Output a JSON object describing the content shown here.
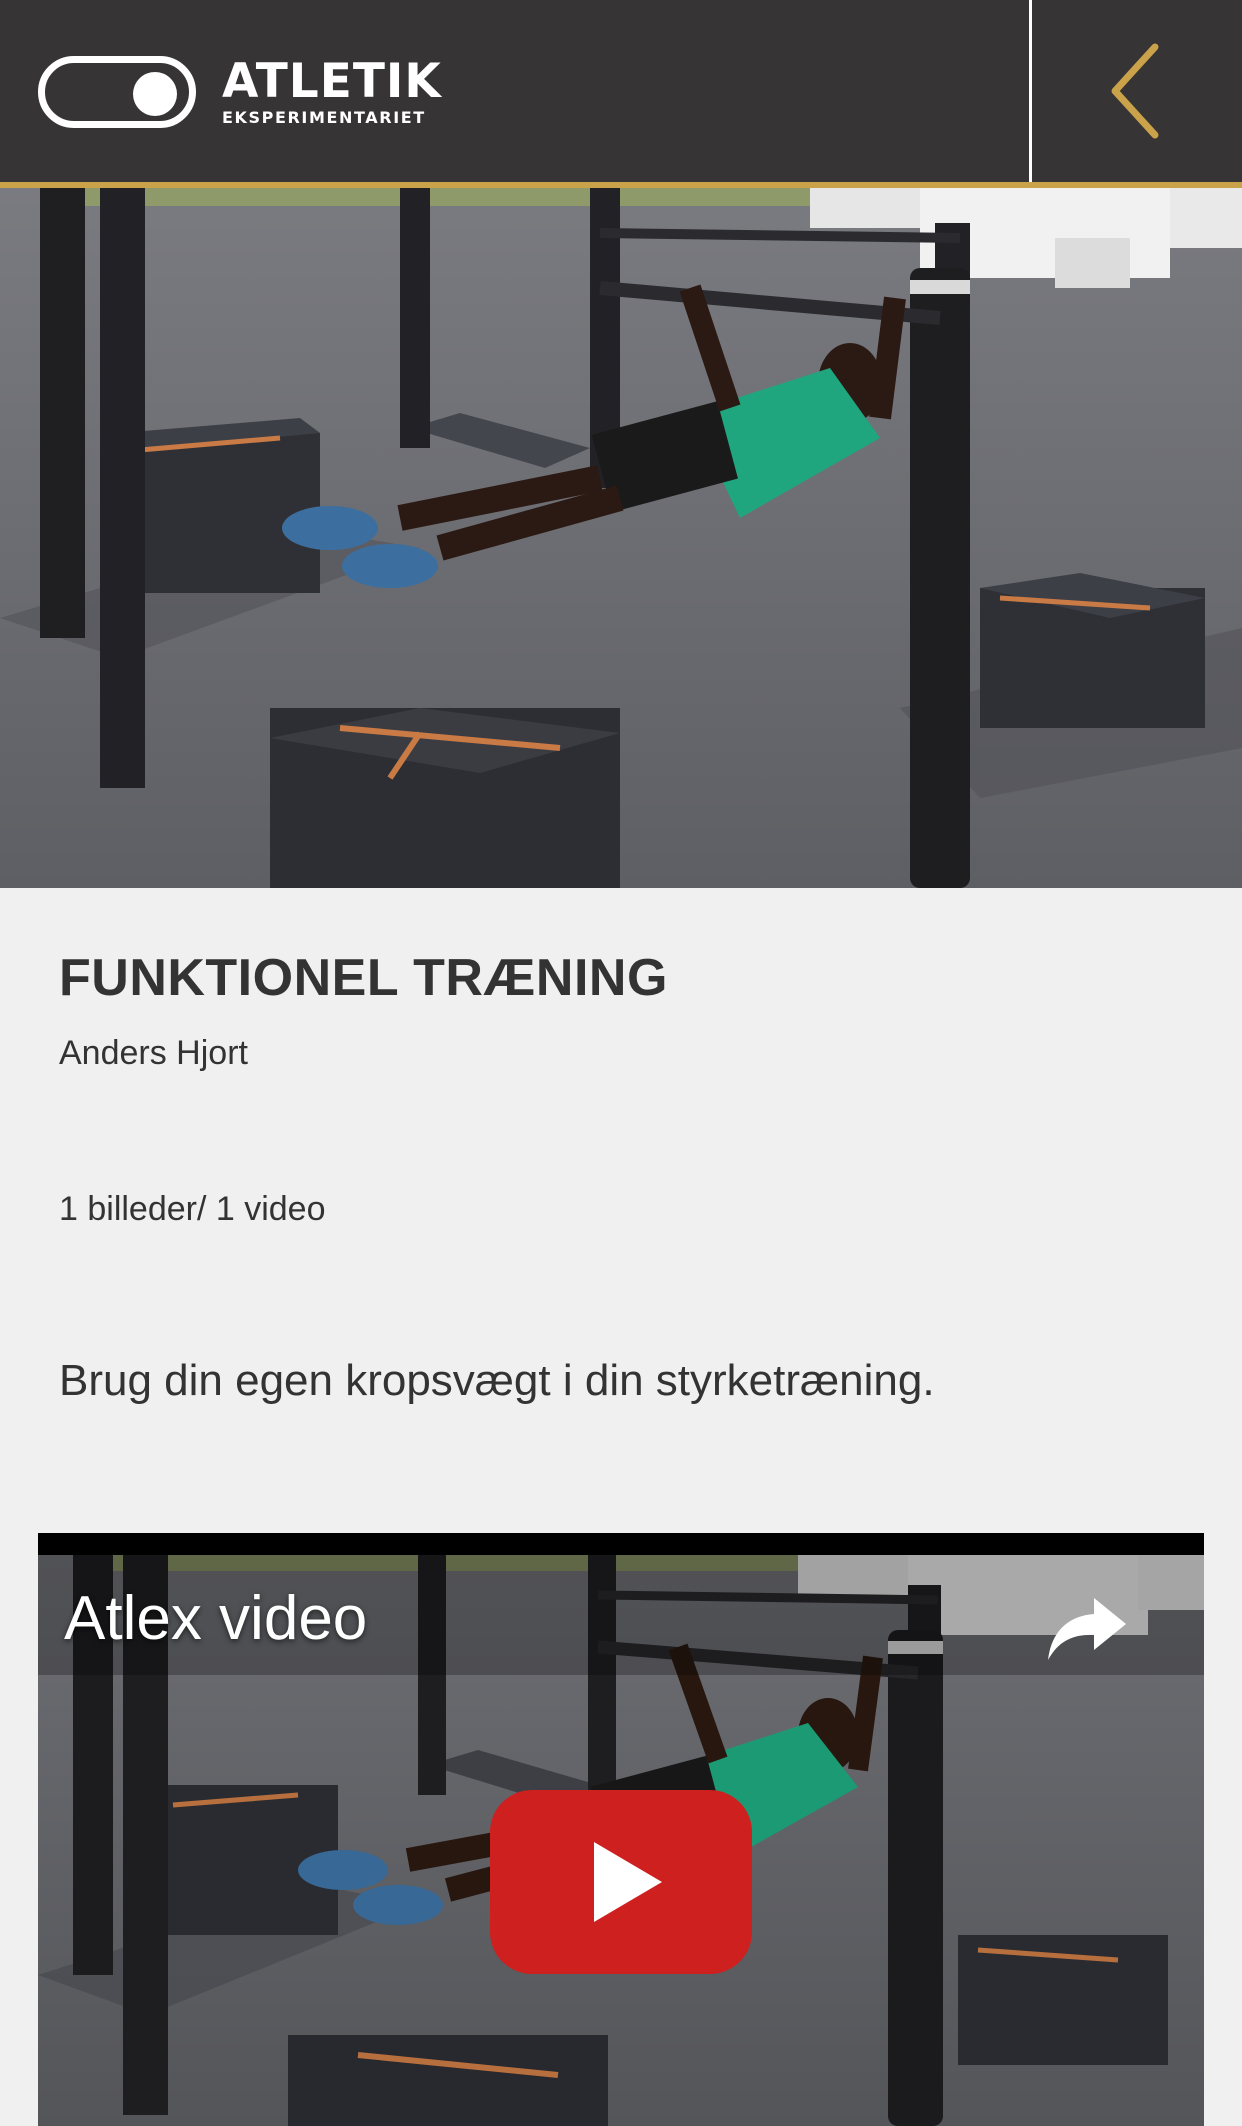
{
  "header": {
    "app_name": "ATLETIK",
    "app_subtitle": "EKSPERIMENTARIET",
    "colors": {
      "background": "#373435",
      "accent_gold": "#c9a24a"
    },
    "icons": {
      "logo": "toggle-switch-icon",
      "back": "chevron-left-icon"
    }
  },
  "hero": {
    "image": "outdoor-fitness-park-inverted-row-photo"
  },
  "article": {
    "title": "FUNKTIONEL TRÆNING",
    "author": "Anders Hjort",
    "media_count": "1 billeder/ 1 video",
    "description": "Brug din egen kropsvægt i din styrketræning."
  },
  "video": {
    "title": "Atlex video",
    "icons": {
      "share": "share-arrow-icon",
      "play": "youtube-play-icon"
    },
    "colors": {
      "play_button": "#cd201f"
    }
  }
}
